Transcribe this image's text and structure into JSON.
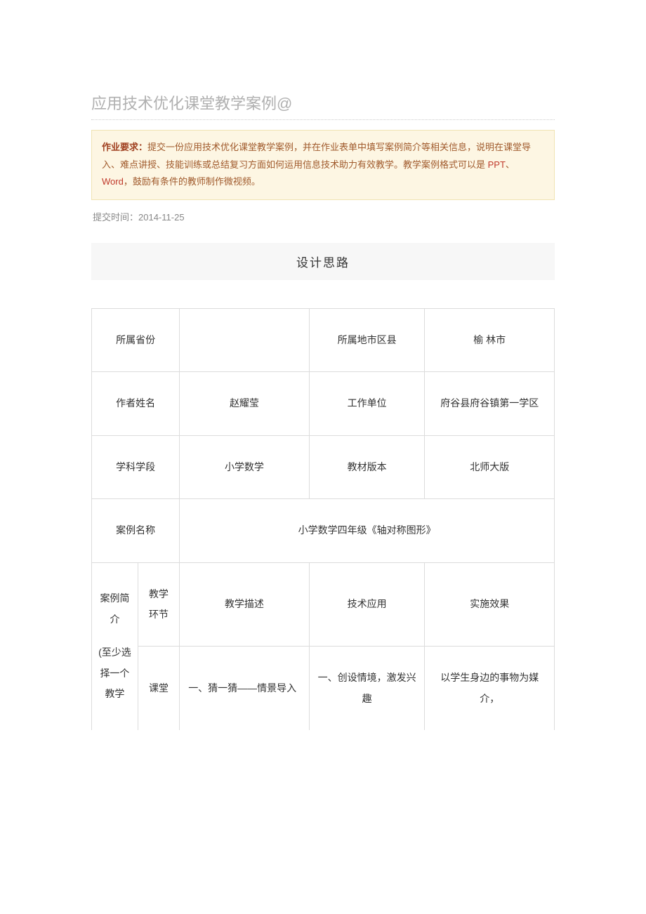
{
  "title": "应用技术优化课堂教学案例@",
  "requirement": {
    "label": "作业要求：",
    "body_a": "提交一份应用技术优化课堂教学案例，并在作业表单中填写案例简介等相关信息，说明在课堂导入、难点讲授、技能训练或总结复习方面如何运用信息技术助力有效教学。教学案例格式可以是 ",
    "hl1": "PPT",
    "sep": "、",
    "hl2": "Word",
    "body_b": "，鼓励有条件的教师制作微视频。"
  },
  "submit": {
    "label": "提交时间：",
    "value": "2014-11-25"
  },
  "section_title": "设计思路",
  "rows": {
    "r1": {
      "k1": "所属省份",
      "v1": "",
      "k2": "所属地市区县",
      "v2": "榆  林市"
    },
    "r2": {
      "k1": "作者姓名",
      "v1": "赵耀莹",
      "k2": "工作单位",
      "v2": "府谷县府谷镇第一学区"
    },
    "r3": {
      "k1": "学科学段",
      "v1": "小学数学",
      "k2": "教材版本",
      "v2": "北师大版"
    },
    "r4": {
      "k1": "案例名称",
      "v1": "小学数学四年级《轴对称图形》"
    },
    "r5": {
      "k1": "案例简介",
      "sub": "(至少选择一个教学",
      "c2a": "教学环节",
      "c3a": "教学描述",
      "c4a": "技术应用",
      "c5a": "实施效果",
      "c2b": "课堂",
      "c3b": "一、猜一猜——情景导入",
      "c4b": "一、创设情境，激发兴趣",
      "c5b": "以学生身边的事物为媒介，"
    }
  }
}
